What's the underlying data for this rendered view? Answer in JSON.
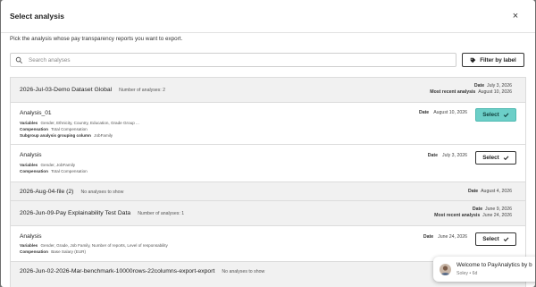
{
  "modal": {
    "title": "Select analysis",
    "close_symbol": "×",
    "instructions": "Pick the analysis whose pay transparency reports you want to export."
  },
  "search": {
    "placeholder": "Search analyses",
    "value": ""
  },
  "filter": {
    "label": "Filter by label"
  },
  "labels": {
    "date": "Date",
    "most_recent": "Most recent analysis",
    "variables": "Variables",
    "compensation": "Compensation",
    "subgroup": "Subgroup analysis grouping column",
    "select": "Select"
  },
  "groups": [
    {
      "name": "2026-Jul-03-Demo Dataset Global",
      "count": "Number of analyses: 2",
      "date": "July 3, 2026",
      "most_recent": "August 10, 2026"
    },
    {
      "name": "2026-Aug-04-file (2)",
      "count": "No analyses to show",
      "date": "August 4, 2026"
    },
    {
      "name": "2026-Jun-09-Pay Explainability Test Data",
      "count": "Number of analyses: 1",
      "date": "June 9, 2026",
      "most_recent": "June 24, 2026"
    },
    {
      "name": "2026-Jun-02-2026-Mar-benchmark-10000rows-22columns-export-export",
      "count": "No analyses to show"
    }
  ],
  "analyses": [
    {
      "name": "Analysis_01",
      "variables": "Gender, Ethnicity, Country, Education, Grade Group ...",
      "compensation": "Total Compensation",
      "subgroup": "JobFamily",
      "date": "August 10, 2026",
      "state": "active"
    },
    {
      "name": "Analysis",
      "variables": "Gender, JobFamily",
      "compensation": "Total Compensation",
      "date": "July 3, 2026",
      "state": "outline"
    },
    {
      "name": "Analysis",
      "variables": "Gender, Grade, Job Family, Number of reports, Level of responsability",
      "compensation": "Base Salary (EUR)",
      "date": "June 24, 2026",
      "state": "outline"
    }
  ],
  "chat": {
    "message": "Welcome to PayAnalytics by b",
    "sender": "Soley • 6d"
  },
  "colors": {
    "accent": "#6ccfc8",
    "group_bg": "#f1f1f1"
  }
}
